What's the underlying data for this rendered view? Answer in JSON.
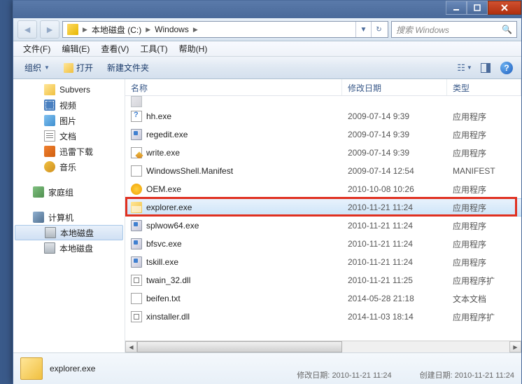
{
  "titlebar": {},
  "nav": {
    "crumbs": [
      "本地磁盘 (C:)",
      "Windows"
    ],
    "search_placeholder": "搜索 Windows"
  },
  "menu": {
    "file": "文件(F)",
    "edit": "编辑(E)",
    "view": "查看(V)",
    "tools": "工具(T)",
    "help": "帮助(H)"
  },
  "toolbar": {
    "organize": "组织",
    "open": "打开",
    "newfolder": "新建文件夹"
  },
  "tree": {
    "items": [
      {
        "label": "Subvers",
        "icon": "ic-folder",
        "lvl": "l2"
      },
      {
        "label": "视频",
        "icon": "ic-video",
        "lvl": "l2"
      },
      {
        "label": "图片",
        "icon": "ic-pic",
        "lvl": "l2"
      },
      {
        "label": "文档",
        "icon": "ic-doc",
        "lvl": "l2"
      },
      {
        "label": "迅雷下载",
        "icon": "ic-dl",
        "lvl": "l2"
      },
      {
        "label": "音乐",
        "icon": "ic-music",
        "lvl": "l2"
      }
    ],
    "homegroup": "家庭组",
    "computer": "计算机",
    "drive_c": "本地磁盘",
    "drive_d": "本地磁盘"
  },
  "columns": {
    "name": "名称",
    "date": "修改日期",
    "type": "类型"
  },
  "files": [
    {
      "name": "hh.exe",
      "date": "2009-07-14 9:39",
      "type": "应用程序",
      "icon": "fi-hh"
    },
    {
      "name": "regedit.exe",
      "date": "2009-07-14 9:39",
      "type": "应用程序",
      "icon": "fi-exe"
    },
    {
      "name": "write.exe",
      "date": "2009-07-14 9:39",
      "type": "应用程序",
      "icon": "fi-write"
    },
    {
      "name": "WindowsShell.Manifest",
      "date": "2009-07-14 12:54",
      "type": "MANIFEST",
      "icon": "fi-man"
    },
    {
      "name": "OEM.exe",
      "date": "2010-10-08 10:26",
      "type": "应用程序",
      "icon": "fi-stop"
    },
    {
      "name": "explorer.exe",
      "date": "2010-11-21 11:24",
      "type": "应用程序",
      "icon": "fi-explorer",
      "sel": true,
      "hl": true
    },
    {
      "name": "splwow64.exe",
      "date": "2010-11-21 11:24",
      "type": "应用程序",
      "icon": "fi-exe"
    },
    {
      "name": "bfsvc.exe",
      "date": "2010-11-21 11:24",
      "type": "应用程序",
      "icon": "fi-exe"
    },
    {
      "name": "tskill.exe",
      "date": "2010-11-21 11:24",
      "type": "应用程序",
      "icon": "fi-exe"
    },
    {
      "name": "twain_32.dll",
      "date": "2010-11-21 11:25",
      "type": "应用程序扩",
      "icon": "fi-dll"
    },
    {
      "name": "beifen.txt",
      "date": "2014-05-28 21:18",
      "type": "文本文档",
      "icon": "fi-txt"
    },
    {
      "name": "xinstaller.dll",
      "date": "2014-11-03 18:14",
      "type": "应用程序扩",
      "icon": "fi-dll"
    }
  ],
  "partial_row": {
    "name": "",
    "icon": "fi-partial"
  },
  "status": {
    "name": "explorer.exe",
    "mod_label": "修改日期:",
    "mod_value": "2010-11-21 11:24",
    "create_label": "创建日期:",
    "create_value": "2010-11-21 11:24"
  }
}
